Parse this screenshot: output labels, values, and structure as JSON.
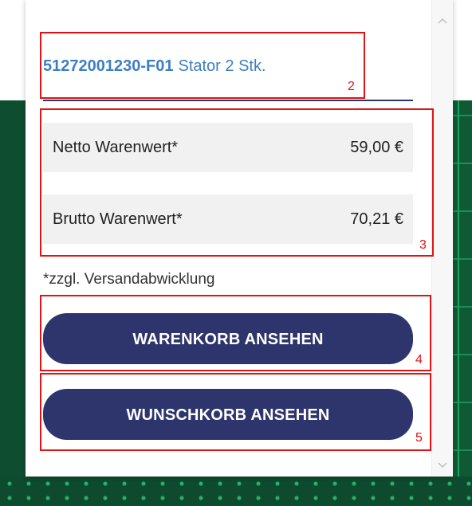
{
  "product": {
    "code": "51272001230-F01",
    "description": "Stator 2 Stk."
  },
  "prices": [
    {
      "label": "Netto Warenwert*",
      "value": "59,00 €"
    },
    {
      "label": "Brutto Warenwert*",
      "value": "70,21 €"
    }
  ],
  "shipping_note": "*zzgl. Versandabwicklung",
  "buttons": {
    "cart": "WARENKORB ANSEHEN",
    "wishlist": "WUNSCHKORB ANSEHEN"
  },
  "scrollbar": {
    "up_icon": "chevron-up-icon",
    "down_icon": "chevron-down-icon"
  },
  "annotations": [
    "2",
    "3",
    "4",
    "5"
  ],
  "colors": {
    "accent": "#2d356c",
    "link": "#3e7fc1",
    "annotation": "#e01414",
    "row_bg": "#f1f1f1"
  }
}
